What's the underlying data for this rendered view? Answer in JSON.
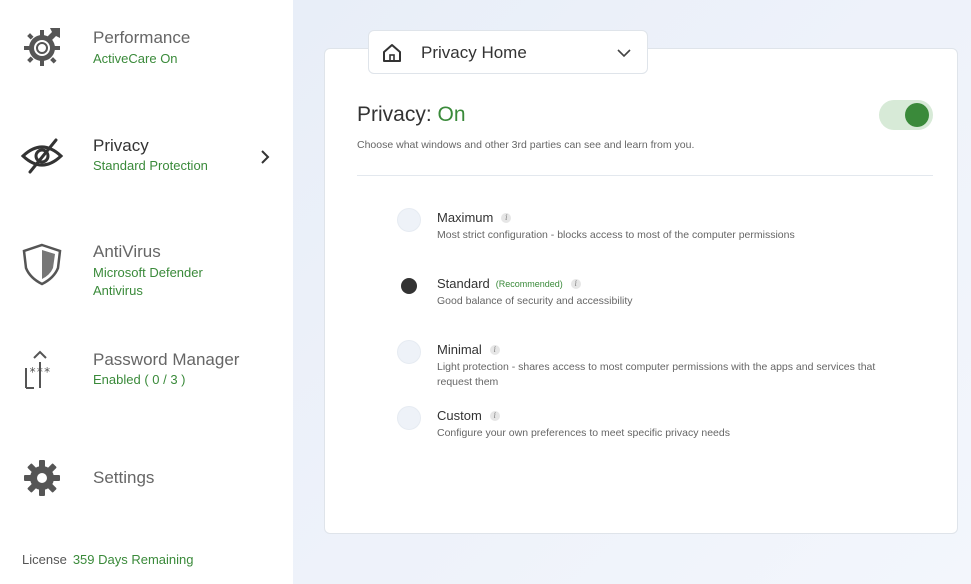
{
  "sidebar": {
    "items": [
      {
        "title": "Performance",
        "subtitle": "ActiveCare On",
        "icon": "performance-gear-icon"
      },
      {
        "title": "Privacy",
        "subtitle": "Standard Protection",
        "icon": "eye-slash-icon",
        "active": true
      },
      {
        "title": "AntiVirus",
        "subtitle_line1": "Microsoft Defender",
        "subtitle_line2": "Antivirus",
        "icon": "shield-icon"
      },
      {
        "title": "Password Manager",
        "subtitle": "Enabled ( 0 / 3 )",
        "icon": "password-upload-icon"
      },
      {
        "title": "Settings",
        "icon": "gear-icon"
      }
    ],
    "license_label": "License",
    "license_value": "359 Days Remaining"
  },
  "main": {
    "dropdown": {
      "label": "Privacy Home",
      "icon": "home-icon"
    },
    "heading_label": "Privacy:",
    "heading_state": "On",
    "description": "Choose what windows and other 3rd parties can see and learn from you.",
    "toggle_on": true,
    "options": [
      {
        "title": "Maximum",
        "desc": "Most strict configuration - blocks access to most of the computer permissions",
        "selected": false
      },
      {
        "title": "Standard",
        "recommended": "(Recommended)",
        "desc": "Good balance of security and accessibility",
        "selected": true
      },
      {
        "title": "Minimal",
        "desc": "Light protection - shares access to most computer permissions with the apps and services that request them",
        "selected": false
      },
      {
        "title": "Custom",
        "desc": "Configure your own preferences to meet specific privacy needs",
        "selected": false
      }
    ],
    "info_glyph": "i"
  },
  "colors": {
    "accent": "#3a8a3a",
    "toggle_track": "#d7ead7",
    "text": "#333333"
  }
}
